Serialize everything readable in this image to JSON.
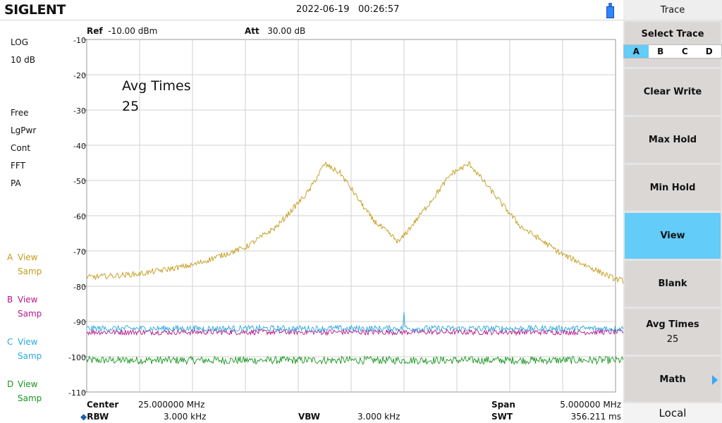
{
  "header": {
    "brand": "SIGLENT",
    "date": "2022-06-19",
    "time": "00:26:57"
  },
  "left_panel": {
    "scale_type": "LOG",
    "scale_div": "10 dB",
    "status": [
      "Free",
      "LgPwr",
      "Cont",
      "FFT",
      "PA"
    ],
    "traces": [
      {
        "letter": "A",
        "state": "View",
        "mode": "Samp",
        "color": "#c49a1a"
      },
      {
        "letter": "B",
        "state": "View",
        "mode": "Samp",
        "color": "#b8168a"
      },
      {
        "letter": "C",
        "state": "View",
        "mode": "Samp",
        "color": "#2aa8e0"
      },
      {
        "letter": "D",
        "state": "View",
        "mode": "Samp",
        "color": "#17951f"
      }
    ]
  },
  "top_info": {
    "ref_label": "Ref",
    "ref_value": "-10.00 dBm",
    "att_label": "Att",
    "att_value": "30.00 dB"
  },
  "overlay": {
    "line1": "Avg Times",
    "line2": "25"
  },
  "bottom_info": {
    "center_label": "Center",
    "center_value": "25.000000 MHz",
    "span_label": "Span",
    "span_value": "5.000000 MHz",
    "rbw_label": "RBW",
    "rbw_value": "3.000 kHz",
    "vbw_label": "VBW",
    "vbw_value": "3.000 kHz",
    "swt_label": "SWT",
    "swt_value": "356.211 ms"
  },
  "menu": {
    "title": "Trace",
    "select_trace": {
      "label": "Select Trace",
      "options": [
        "A",
        "B",
        "C",
        "D"
      ],
      "selected": "A"
    },
    "buttons": [
      {
        "label": "Clear Write"
      },
      {
        "label": "Max Hold"
      },
      {
        "label": "Min Hold"
      },
      {
        "label": "View",
        "active": true
      },
      {
        "label": "Blank"
      },
      {
        "label": "Avg Times",
        "value": "25"
      },
      {
        "label": "Math"
      }
    ],
    "footer": "Local"
  },
  "chart_data": {
    "type": "line",
    "y_ticks": [
      "-10",
      "-20",
      "-30",
      "-40",
      "-50",
      "-60",
      "-70",
      "-80",
      "-90",
      "-100",
      "-110"
    ],
    "ylim": [
      -110,
      -10
    ],
    "xlim_mhz": [
      22.5,
      27.5
    ],
    "grid": true,
    "series": [
      {
        "trace": "A",
        "color": "#c49a1a",
        "points": [
          [
            22.5,
            -77.5
          ],
          [
            23.0,
            -76.5
          ],
          [
            23.5,
            -74.0
          ],
          [
            24.0,
            -69.0
          ],
          [
            24.3,
            -63.0
          ],
          [
            24.6,
            -53.0
          ],
          [
            24.75,
            -45.3
          ],
          [
            24.9,
            -48.0
          ],
          [
            25.2,
            -61.0
          ],
          [
            25.45,
            -67.5
          ],
          [
            25.7,
            -58.0
          ],
          [
            25.95,
            -48.0
          ],
          [
            26.12,
            -45.3
          ],
          [
            26.3,
            -52.0
          ],
          [
            26.6,
            -63.0
          ],
          [
            27.0,
            -71.0
          ],
          [
            27.5,
            -78.0
          ],
          [
            28.1,
            -81.0
          ],
          [
            28.3,
            -81.5
          ]
        ]
      },
      {
        "trace": "B",
        "color": "#b8168a",
        "points": [
          [
            22.5,
            -93.0
          ],
          [
            28.3,
            -93.0
          ]
        ]
      },
      {
        "trace": "C",
        "color": "#2aa8e0",
        "points": [
          [
            22.5,
            -92.0
          ],
          [
            25.49,
            -92.0
          ],
          [
            25.5,
            -87.0
          ],
          [
            25.51,
            -92.0
          ],
          [
            28.3,
            -92.0
          ]
        ]
      },
      {
        "trace": "D",
        "color": "#17951f",
        "points": [
          [
            22.5,
            -101.0
          ],
          [
            28.3,
            -101.0
          ]
        ]
      }
    ]
  }
}
